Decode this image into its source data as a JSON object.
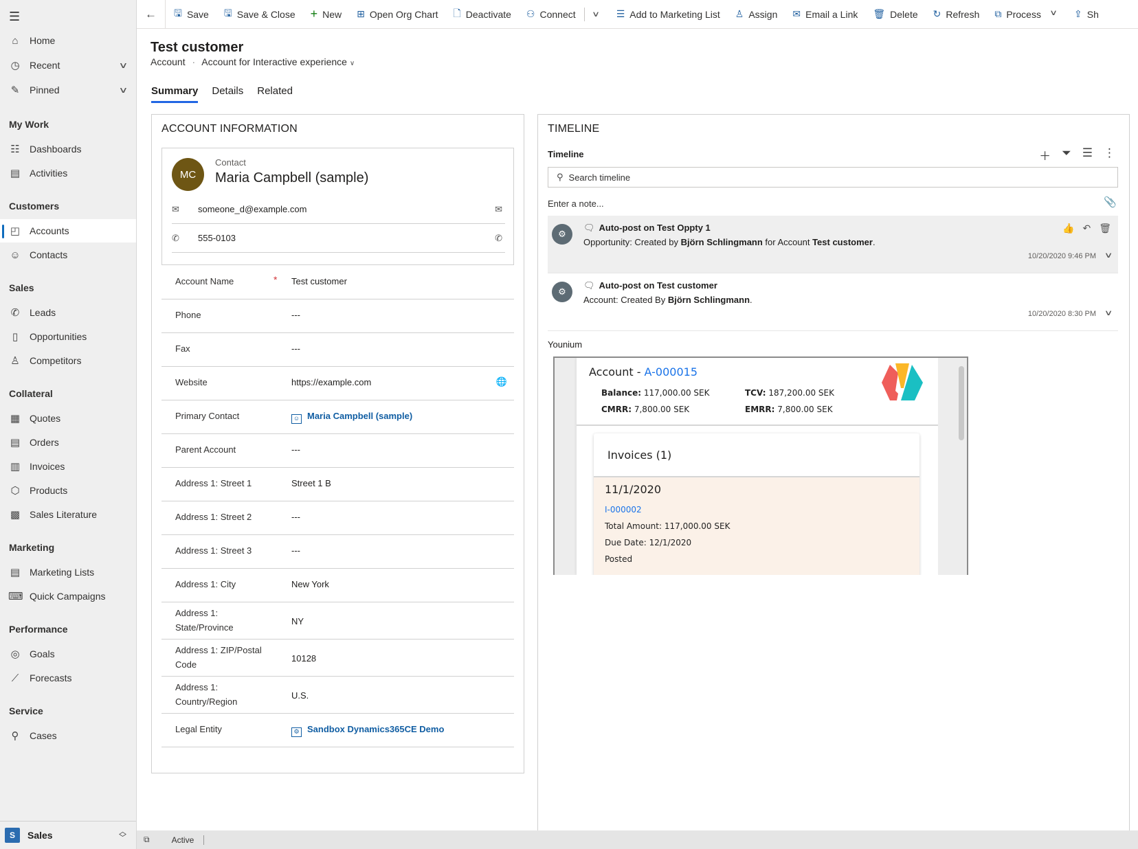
{
  "sidebar": {
    "top_items": [
      {
        "label": "Home",
        "icon": "home-icon",
        "glyph": "⌂"
      },
      {
        "label": "Recent",
        "icon": "clock-icon",
        "glyph": "◷",
        "chevron": true
      },
      {
        "label": "Pinned",
        "icon": "pin-icon",
        "glyph": "✎",
        "chevron": true
      }
    ],
    "groups": [
      {
        "title": "My Work",
        "items": [
          {
            "label": "Dashboards",
            "icon": "dashboard-icon",
            "glyph": "☷"
          },
          {
            "label": "Activities",
            "icon": "clipboard-icon",
            "glyph": "▤"
          }
        ]
      },
      {
        "title": "Customers",
        "items": [
          {
            "label": "Accounts",
            "icon": "account-icon",
            "glyph": "◰",
            "active": true
          },
          {
            "label": "Contacts",
            "icon": "person-icon",
            "glyph": "☺"
          }
        ]
      },
      {
        "title": "Sales",
        "items": [
          {
            "label": "Leads",
            "icon": "lead-phone-icon",
            "glyph": "✆"
          },
          {
            "label": "Opportunities",
            "icon": "opportunity-icon",
            "glyph": "▯"
          },
          {
            "label": "Competitors",
            "icon": "competitor-icon",
            "glyph": "♙"
          }
        ]
      },
      {
        "title": "Collateral",
        "items": [
          {
            "label": "Quotes",
            "icon": "quote-icon",
            "glyph": "▦"
          },
          {
            "label": "Orders",
            "icon": "order-icon",
            "glyph": "▤"
          },
          {
            "label": "Invoices",
            "icon": "invoice-icon",
            "glyph": "▥"
          },
          {
            "label": "Products",
            "icon": "product-box-icon",
            "glyph": "⬡"
          },
          {
            "label": "Sales Literature",
            "icon": "sales-literature-icon",
            "glyph": "▩"
          }
        ]
      },
      {
        "title": "Marketing",
        "items": [
          {
            "label": "Marketing Lists",
            "icon": "marketing-list-icon",
            "glyph": "▤"
          },
          {
            "label": "Quick Campaigns",
            "icon": "campaign-icon",
            "glyph": "⌨"
          }
        ]
      },
      {
        "title": "Performance",
        "items": [
          {
            "label": "Goals",
            "icon": "target-icon",
            "glyph": "◎"
          },
          {
            "label": "Forecasts",
            "icon": "forecast-chart-icon",
            "glyph": "⟋"
          }
        ]
      },
      {
        "title": "Service",
        "items": [
          {
            "label": "Cases",
            "icon": "wrench-icon",
            "glyph": "⚲"
          }
        ]
      }
    ],
    "area": {
      "badge": "S",
      "label": "Sales"
    }
  },
  "toolbar": {
    "items": [
      {
        "label": "Save",
        "icon": "save-icon",
        "glyph": "🖫"
      },
      {
        "label": "Save & Close",
        "icon": "save-close-icon",
        "glyph": "🖫"
      },
      {
        "label": "New",
        "icon": "plus-icon",
        "glyph": "+"
      },
      {
        "label": "Open Org Chart",
        "icon": "org-chart-icon",
        "glyph": "⊞"
      },
      {
        "label": "Deactivate",
        "icon": "deactivate-icon",
        "glyph": "🗋"
      },
      {
        "label": "Connect",
        "icon": "connect-icon",
        "glyph": "⚇"
      }
    ],
    "items2": [
      {
        "label": "Add to Marketing List",
        "icon": "add-list-icon",
        "glyph": "☰"
      },
      {
        "label": "Assign",
        "icon": "assign-icon",
        "glyph": "♙"
      },
      {
        "label": "Email a Link",
        "icon": "email-link-icon",
        "glyph": "✉"
      },
      {
        "label": "Delete",
        "icon": "trash-icon",
        "glyph": "🗑"
      },
      {
        "label": "Refresh",
        "icon": "refresh-icon",
        "glyph": "↻"
      },
      {
        "label": "Process",
        "icon": "process-icon",
        "glyph": "⧉"
      }
    ],
    "share_label": "Sh"
  },
  "record": {
    "title": "Test customer",
    "entity": "Account",
    "form": "Account for Interactive experience",
    "tabs": [
      "Summary",
      "Details",
      "Related"
    ]
  },
  "account_info": {
    "section_title": "ACCOUNT INFORMATION",
    "contact": {
      "label": "Contact",
      "initials": "MC",
      "name": "Maria Campbell (sample)",
      "email": "someone_d@example.com",
      "phone": "555-0103",
      "avatar_color": "#6e5614"
    },
    "fields": [
      {
        "label": "Account Name",
        "value": "Test customer",
        "required": true
      },
      {
        "label": "Phone",
        "value": "---"
      },
      {
        "label": "Fax",
        "value": "---"
      },
      {
        "label": "Website",
        "value": "https://example.com",
        "action": "globe-icon"
      },
      {
        "label": "Primary Contact",
        "value": "Maria Campbell (sample)",
        "link": true
      },
      {
        "label": "Parent Account",
        "value": "---"
      },
      {
        "label": "Address 1: Street 1",
        "value": "Street 1 B"
      },
      {
        "label": "Address 1: Street 2",
        "value": "---"
      },
      {
        "label": "Address 1: Street 3",
        "value": "---"
      },
      {
        "label": "Address 1: City",
        "value": "New York"
      },
      {
        "label": "Address 1: State/Province",
        "value": "NY"
      },
      {
        "label": "Address 1: ZIP/Postal Code",
        "value": "10128"
      },
      {
        "label": "Address 1: Country/Region",
        "value": "U.S."
      },
      {
        "label": "Legal Entity",
        "value": "Sandbox Dynamics365CE Demo",
        "link": true
      }
    ]
  },
  "timeline": {
    "section_title": "TIMELINE",
    "header": "Timeline",
    "search_placeholder": "Search timeline",
    "note_placeholder": "Enter a note...",
    "posts": [
      {
        "title": "Auto-post on Test Oppty 1",
        "body_pre": "Opportunity: Created by ",
        "author": "Björn Schlingmann",
        "body_mid": " for Account ",
        "target": "Test customer",
        "body_post": ".",
        "date": "10/20/2020 9:46 PM",
        "highlighted": true
      },
      {
        "title": "Auto-post on Test customer",
        "body_pre": "Account: Created By ",
        "author": "Björn Schlingmann",
        "body_mid": ".",
        "target": "",
        "body_post": "",
        "date": "10/20/2020 8:30 PM",
        "highlighted": false
      }
    ]
  },
  "younium": {
    "label": "Younium",
    "account_prefix": "Account - ",
    "account_id": "A-000015",
    "stats": [
      {
        "key": "Balance:",
        "value": "117,000.00 SEK"
      },
      {
        "key": "TCV:",
        "value": "187,200.00 SEK"
      },
      {
        "key": "CMRR:",
        "value": "7,800.00 SEK"
      },
      {
        "key": "EMRR:",
        "value": "7,800.00 SEK"
      }
    ],
    "invoices_title": "Invoices (1)",
    "invoice": {
      "date": "11/1/2020",
      "id": "I-000002",
      "total": "Total Amount: 117,000.00 SEK",
      "due": "Due Date: 12/1/2020",
      "status": "Posted"
    },
    "colors": {
      "link": "#1a73e8",
      "logo_red": "#ef5e5a",
      "logo_yellow": "#fbb728",
      "logo_teal": "#1abfc3",
      "invoice_bg": "#fbf1e8"
    }
  },
  "status_bar": {
    "status": "Active"
  }
}
